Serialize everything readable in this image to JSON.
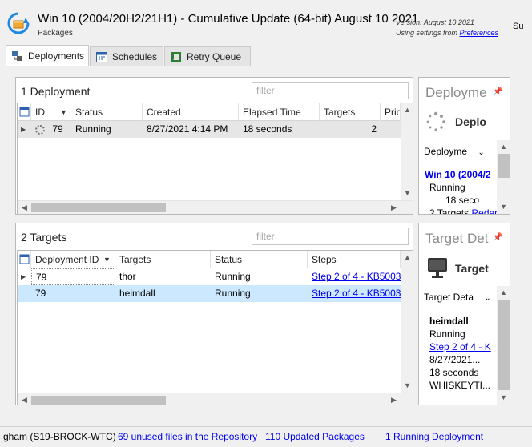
{
  "header": {
    "title": "Win 10 (2004/20H2/21H1) - Cumulative Update (64-bit) August 10 2021",
    "subtitle": "Packages",
    "version_text": "Version: August 10 2021",
    "using_text": "Using settings from ",
    "using_link": "Preferences",
    "cut_label": "Su"
  },
  "tabs": [
    {
      "label": "Deployments",
      "icon": "deployments-icon",
      "active": true
    },
    {
      "label": "Schedules",
      "icon": "calendar-icon",
      "active": false
    },
    {
      "label": "Retry Queue",
      "icon": "retry-icon",
      "active": false
    }
  ],
  "deployments_panel": {
    "title": "1 Deployment",
    "filter_placeholder": "filter",
    "columns": [
      "ID",
      "Status",
      "Created",
      "Elapsed Time",
      "Targets",
      "Prio"
    ],
    "rows": [
      {
        "id": "79",
        "status": "Running",
        "created": "8/27/2021 4:14 PM",
        "elapsed": "18 seconds",
        "targets": "2",
        "prio": ""
      }
    ]
  },
  "targets_panel": {
    "title": "2 Targets",
    "filter_placeholder": "filter",
    "columns": [
      "Deployment ID",
      "Targets",
      "Status",
      "Steps"
    ],
    "rows": [
      {
        "deployment_id": "79",
        "target": "thor",
        "status": "Running",
        "steps": "Step 2 of 4 - KB5003"
      },
      {
        "deployment_id": "79",
        "target": "heimdall",
        "status": "Running",
        "steps": "Step 2 of 4 - KB5003"
      }
    ]
  },
  "deployment_side": {
    "title": "Deployme",
    "heading": "Deplo",
    "dropdown": "Deployme",
    "link": "Win 10 (2004/2",
    "status": "Running",
    "elapsed": "18 seco",
    "targets_text": "2 Targets ",
    "targets_link": "Redep"
  },
  "target_side": {
    "title": "Target Det",
    "heading": "Target",
    "dropdown": "Target Deta",
    "name": "heimdall",
    "status": "Running",
    "step_link": "Step 2 of 4 - K",
    "date": "8/27/2021...",
    "elapsed": "18 seconds",
    "host": "WHISKEYTI..."
  },
  "statusbar": {
    "left_text": "gham  (S19-BROCK-WTC)",
    "unused_files": "69 unused files in the Repository",
    "updated_packages": "110 Updated Packages",
    "running_deployment": "1 Running Deployment"
  },
  "colors": {
    "accent_blue": "#0078d7",
    "selection": "#cce8ff",
    "link": "#0000ee"
  }
}
